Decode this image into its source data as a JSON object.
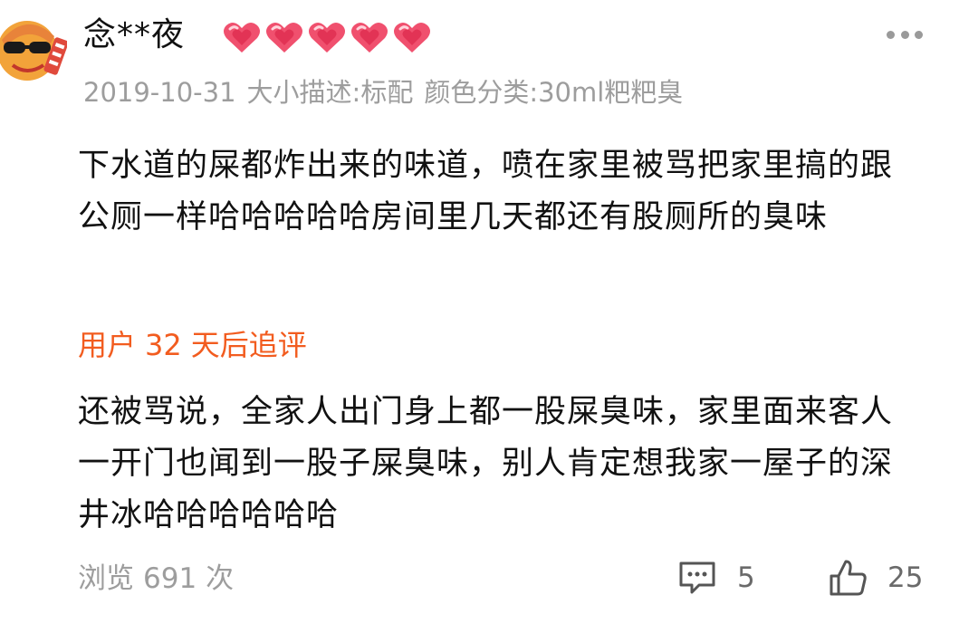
{
  "review": {
    "user": {
      "name": "念**夜",
      "avatar_icon": "cartoon-avatar-icon",
      "level_hearts": 5,
      "heart_icon": "heart-level-icon",
      "heart_color": "#f0506e"
    },
    "more_icon": "more-dots-icon",
    "meta": {
      "date": "2019-10-31",
      "size_spec": "大小描述:标配",
      "color_spec": "颜色分类:30ml粑粑臭"
    },
    "content": "下水道的屎都炸出来的味道，喷在家里被骂把家里搞的跟公厕一样哈哈哈哈哈房间里几天都还有股厕所的臭味",
    "followup": {
      "prefix": "用户",
      "days": "32",
      "suffix": "天后追评",
      "accent_color": "#f25c1f",
      "content": "还被骂说，全家人出门身上都一股屎臭味，家里面来客人一开门也闻到一股子屎臭味，别人肯定想我家一屋子的深井冰哈哈哈哈哈哈"
    },
    "footer": {
      "views_label": "浏览",
      "views_count": "691",
      "views_unit": "次",
      "comment_icon": "comment-icon",
      "comment_count": "5",
      "like_icon": "thumbs-up-icon",
      "like_count": "25"
    }
  }
}
